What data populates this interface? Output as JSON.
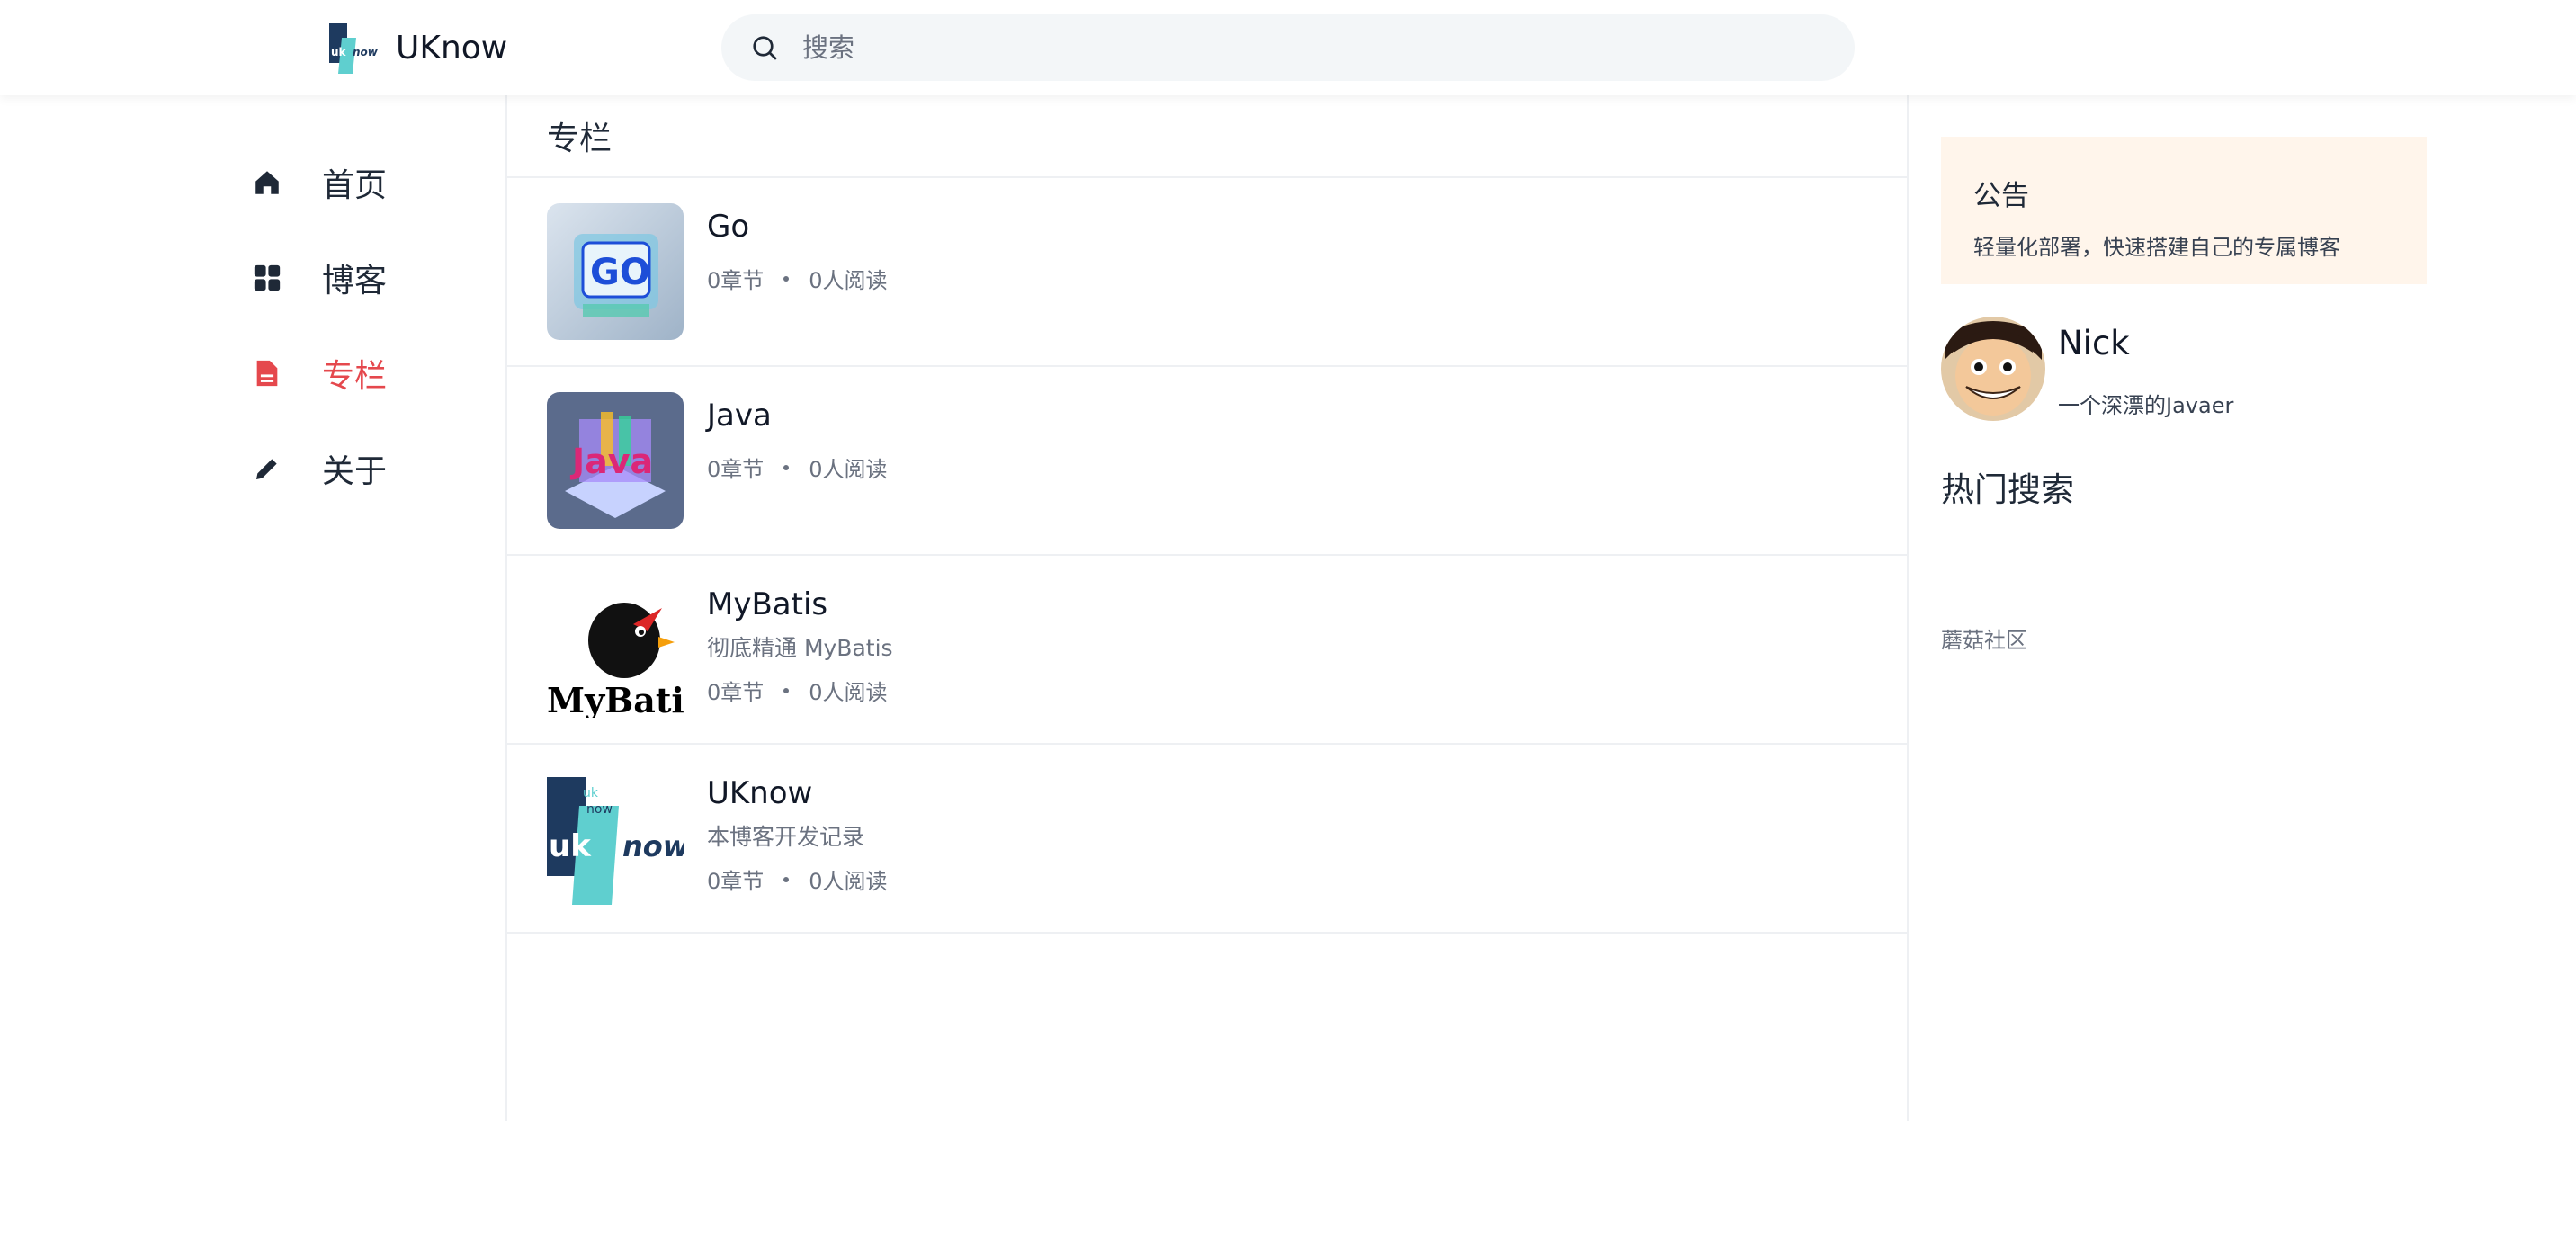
{
  "header": {
    "brand_name": "UKnow",
    "search": {
      "placeholder": "搜索",
      "value": ""
    }
  },
  "nav": {
    "items": [
      {
        "label": "首页",
        "icon": "home-icon",
        "active": false
      },
      {
        "label": "博客",
        "icon": "grid-icon",
        "active": false
      },
      {
        "label": "专栏",
        "icon": "document-icon",
        "active": true
      },
      {
        "label": "关于",
        "icon": "pencil-icon",
        "active": false
      }
    ]
  },
  "main": {
    "title": "专栏",
    "columns": [
      {
        "title": "Go",
        "desc": "",
        "chapters": "0章节",
        "readers": "0人阅读"
      },
      {
        "title": "Java",
        "desc": "",
        "chapters": "0章节",
        "readers": "0人阅读"
      },
      {
        "title": "MyBatis",
        "desc": "彻底精通 MyBatis",
        "chapters": "0章节",
        "readers": "0人阅读"
      },
      {
        "title": "UKnow",
        "desc": "本博客开发记录",
        "chapters": "0章节",
        "readers": "0人阅读"
      }
    ]
  },
  "aside": {
    "notice": {
      "title": "公告",
      "text": "轻量化部署，快速搭建自己的专属博客"
    },
    "profile": {
      "name": "Nick",
      "bio": "一个深漂的Javaer"
    },
    "hot_search_title": "热门搜索",
    "friend_link": "蘑菇社区"
  },
  "colors": {
    "accent": "#e5484d",
    "notice_bg": "#fff5eb",
    "search_bg": "#f3f6f8"
  }
}
